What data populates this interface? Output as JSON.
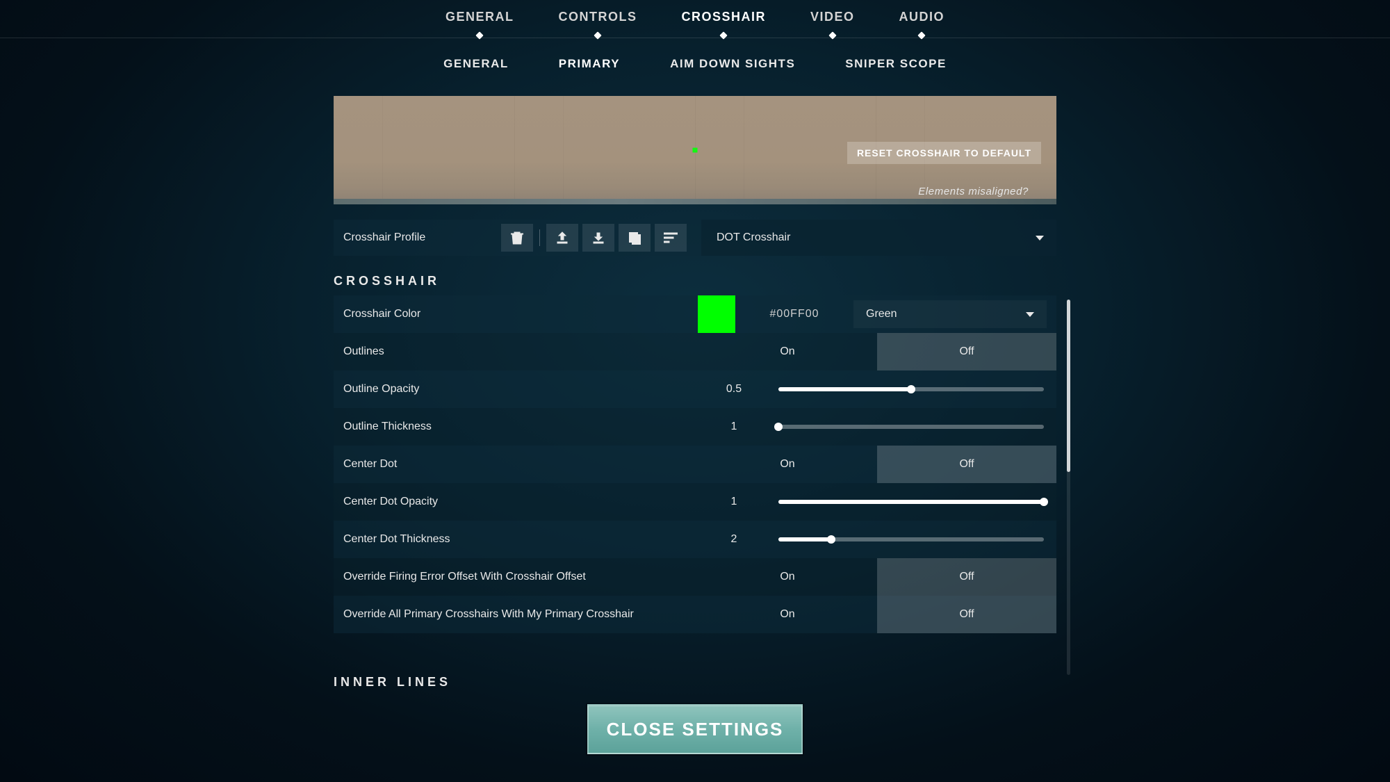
{
  "top_tabs": {
    "general": "GENERAL",
    "controls": "CONTROLS",
    "crosshair": "CROSSHAIR",
    "video": "VIDEO",
    "audio": "AUDIO",
    "active": "crosshair"
  },
  "sub_tabs": {
    "general": "GENERAL",
    "primary": "PRIMARY",
    "ads": "AIM DOWN SIGHTS",
    "sniper": "SNIPER SCOPE",
    "active": "primary"
  },
  "preview": {
    "reset_label": "RESET CROSSHAIR TO DEFAULT",
    "misaligned_label": "Elements misaligned?"
  },
  "profile": {
    "label": "Crosshair Profile",
    "selected": "DOT Crosshair",
    "icons": {
      "delete": "delete-icon",
      "upload": "upload-icon",
      "download": "download-icon",
      "copy": "copy-icon",
      "list": "list-icon"
    }
  },
  "section": {
    "crosshair": "CROSSHAIR",
    "inner_lines": "INNER LINES"
  },
  "settings": {
    "color": {
      "label": "Crosshair Color",
      "hex": "#00FF00",
      "name": "Green",
      "swatch": "#00ff00"
    },
    "outlines": {
      "label": "Outlines",
      "on": "On",
      "off": "Off",
      "value": "off"
    },
    "outline_opacity": {
      "label": "Outline Opacity",
      "value": "0.5",
      "pct": 50
    },
    "outline_thickness": {
      "label": "Outline Thickness",
      "value": "1",
      "pct": 0
    },
    "center_dot": {
      "label": "Center Dot",
      "on": "On",
      "off": "Off",
      "value": "off"
    },
    "center_dot_opacity": {
      "label": "Center Dot Opacity",
      "value": "1",
      "pct": 100
    },
    "center_dot_thickness": {
      "label": "Center Dot Thickness",
      "value": "2",
      "pct": 20
    },
    "override_firing": {
      "label": "Override Firing Error Offset With Crosshair Offset",
      "on": "On",
      "off": "Off",
      "value": "off"
    },
    "override_primary": {
      "label": "Override All Primary Crosshairs With My Primary Crosshair",
      "on": "On",
      "off": "Off",
      "value": "off"
    }
  },
  "close_label": "CLOSE SETTINGS"
}
